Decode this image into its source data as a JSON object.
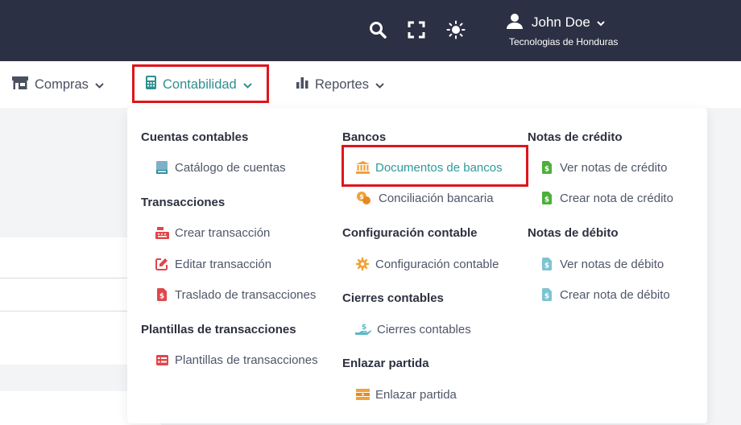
{
  "header": {
    "icons": [
      "search-icon",
      "fullscreen-icon",
      "brightness-icon",
      "user-icon"
    ],
    "user_name": "John Doe",
    "company": "Tecnologias de Honduras"
  },
  "nav": {
    "items": [
      {
        "label": "Compras",
        "icon": "store-icon"
      },
      {
        "label": "Contabilidad",
        "icon": "calculator-icon",
        "active": true
      },
      {
        "label": "Reportes",
        "icon": "bar-chart-icon"
      }
    ]
  },
  "menu": {
    "col1": {
      "sections": [
        {
          "title": "Cuentas contables",
          "links": [
            {
              "label": "Catálogo de cuentas",
              "icon": "book-icon"
            }
          ]
        },
        {
          "title": "Transacciones",
          "links": [
            {
              "label": "Crear transacción",
              "icon": "cash-register-icon"
            },
            {
              "label": "Editar transacción",
              "icon": "edit-icon"
            },
            {
              "label": "Traslado de transacciones",
              "icon": "file-transfer-icon"
            }
          ]
        },
        {
          "title": "Plantillas de transacciones",
          "links": [
            {
              "label": "Plantillas de transacciones",
              "icon": "table-list-icon"
            }
          ]
        }
      ]
    },
    "col2": {
      "sections": [
        {
          "title": "Bancos",
          "links": [
            {
              "label": "Documentos de bancos",
              "icon": "bank-icon",
              "active": true
            },
            {
              "label": "Conciliación bancaria",
              "icon": "coins-icon"
            }
          ]
        },
        {
          "title": "Configuración contable",
          "links": [
            {
              "label": "Configuración contable",
              "icon": "gear-icon"
            }
          ]
        },
        {
          "title": "Cierres contables",
          "links": [
            {
              "label": "Cierres contables",
              "icon": "hand-coin-icon"
            }
          ]
        },
        {
          "title": "Enlazar partida",
          "links": [
            {
              "label": "Enlazar partida",
              "icon": "money-stack-icon"
            }
          ]
        }
      ]
    },
    "col3": {
      "sections": [
        {
          "title": "Notas de crédito",
          "links": [
            {
              "label": "Ver notas de crédito",
              "icon": "invoice-dollar-icon"
            },
            {
              "label": "Crear nota de crédito",
              "icon": "invoice-dollar-icon"
            }
          ]
        },
        {
          "title": "Notas de débito",
          "links": [
            {
              "label": "Ver notas de débito",
              "icon": "invoice-dollar-icon"
            },
            {
              "label": "Crear nota de débito",
              "icon": "invoice-dollar-icon"
            }
          ]
        }
      ]
    }
  },
  "colors": {
    "header_bg": "#2c3044",
    "accent": "#2f9a9a",
    "highlight": "#e0141b"
  }
}
